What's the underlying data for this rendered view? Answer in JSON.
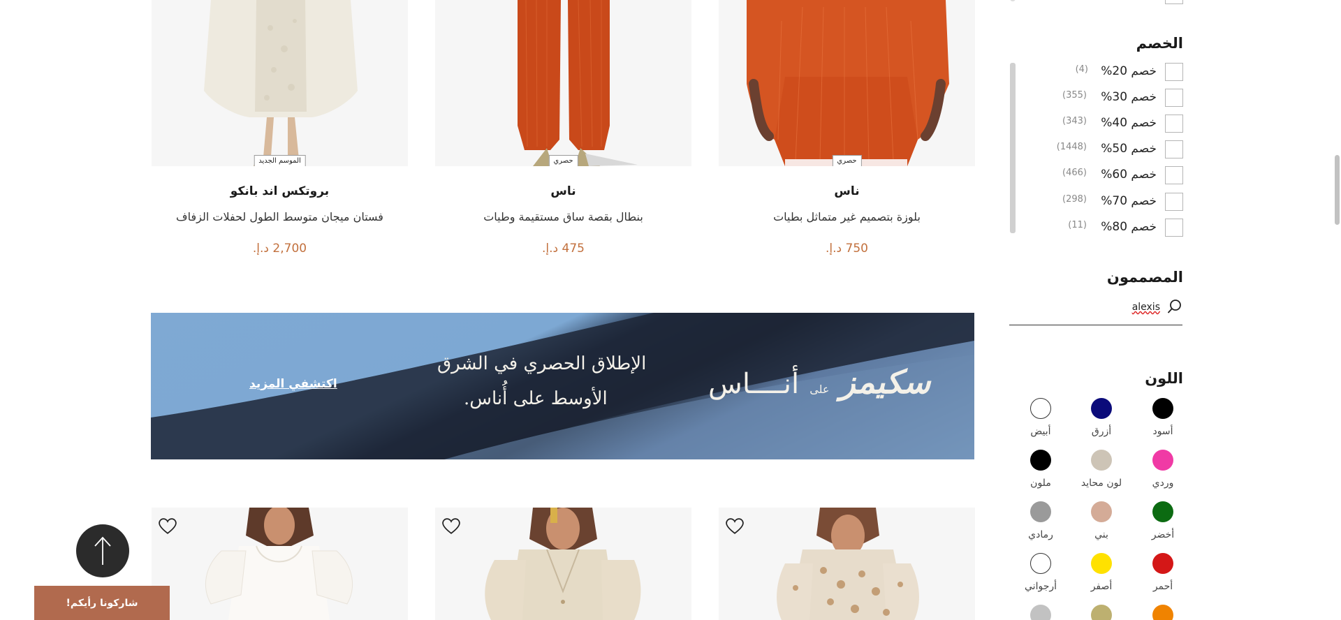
{
  "products_top": [
    {
      "brand": "بروتكس اند بانكو",
      "name": "فستان ميجان متوسط الطول لحفلات الزفاف",
      "price": "2,700 د.إ.",
      "tag": "الموسم الجديد"
    },
    {
      "brand": "ناس",
      "name": "بنطال بقصة ساق مستقيمة وطيات",
      "price": "475 د.إ.",
      "tag": "حصري"
    },
    {
      "brand": "ناس",
      "name": "بلوزة بتصميم غير متماثل بطيات",
      "price": "750 د.إ.",
      "tag": "حصري"
    }
  ],
  "banner": {
    "line1": "الإطلاق الحصري في الشرق",
    "line2": "الأوسط على أُناس.",
    "cta": "اكتشفي المزيد",
    "logo_main": "سكيمز",
    "logo_on": "على",
    "logo_ounass": "أنــــاس"
  },
  "sidebar": {
    "discount_title": "الخصم",
    "discounts": [
      {
        "label": "خصم 20%",
        "count": "(4)"
      },
      {
        "label": "خصم 30%",
        "count": "(355)"
      },
      {
        "label": "خصم 40%",
        "count": "(343)"
      },
      {
        "label": "خصم 50%",
        "count": "(1448)"
      },
      {
        "label": "خصم 60%",
        "count": "(466)"
      },
      {
        "label": "خصم 70%",
        "count": "(298)"
      },
      {
        "label": "خصم 80%",
        "count": "(11)"
      }
    ],
    "designers_title": "المصممون",
    "designer_search_value": "alexis",
    "color_title": "اللون",
    "colors": [
      {
        "name": "أسود",
        "hex": "#000000"
      },
      {
        "name": "أزرق",
        "hex": "#0b0b7a"
      },
      {
        "name": "أبيض",
        "hex": "#ffffff"
      },
      {
        "name": "وردي",
        "hex": "#f03aa5"
      },
      {
        "name": "لون محايد",
        "hex": "#cdc4b6"
      },
      {
        "name": "ملون",
        "hex": "#000000"
      },
      {
        "name": "أخضر",
        "hex": "#0c6b12"
      },
      {
        "name": "بني",
        "hex": "#d4ab97"
      },
      {
        "name": "رمادي",
        "hex": "#9a9a9a"
      },
      {
        "name": "أحمر",
        "hex": "#d41717"
      },
      {
        "name": "أصفر",
        "hex": "#ffe100"
      },
      {
        "name": "أرجواني",
        "hex": "#ffffff"
      },
      {
        "name": "",
        "hex": "#f08300"
      },
      {
        "name": "",
        "hex": "#bdb070"
      },
      {
        "name": "",
        "hex": "#c2c2c2"
      }
    ]
  },
  "floating": {
    "feedback": "شاركونا رأيكم!"
  }
}
